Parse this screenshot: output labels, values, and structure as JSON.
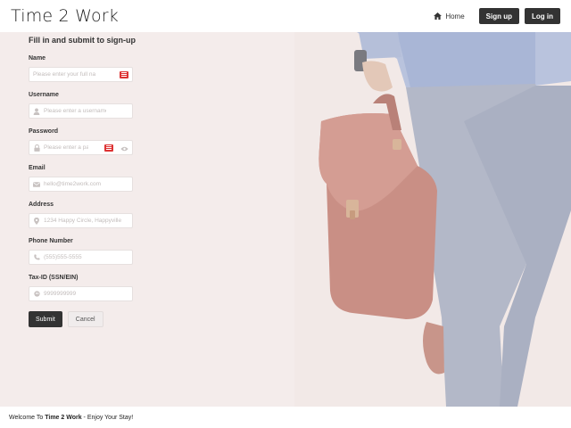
{
  "app": {
    "brand": "Time 2 Work"
  },
  "nav": {
    "home_label": "Home",
    "signup_label": "Sign up",
    "login_label": "Log in"
  },
  "form": {
    "title": "Fill in and submit to sign-up",
    "fields": {
      "name": {
        "label": "Name",
        "placeholder": "Please enter your full name"
      },
      "username": {
        "label": "Username",
        "placeholder": "Please enter a username"
      },
      "password": {
        "label": "Password",
        "placeholder": "Please enter a password"
      },
      "email": {
        "label": "Email",
        "placeholder": "hello@time2work.com"
      },
      "address": {
        "label": "Address",
        "placeholder": "1234 Happy Circle, Happyville"
      },
      "phone": {
        "label": "Phone Number",
        "placeholder": "(555)555-5555"
      },
      "taxid": {
        "label": "Tax-ID (SSN/EIN)",
        "placeholder": "9999999999"
      }
    },
    "submit_label": "Submit",
    "cancel_label": "Cancel"
  },
  "footer": {
    "prefix": "Welcome To ",
    "brand": "Time 2 Work",
    "suffix": " - Enjoy Your Stay!"
  },
  "icons": {
    "home": "home-icon",
    "user": "user-icon",
    "lock": "lock-icon",
    "email": "envelope-icon",
    "address": "map-marker-icon",
    "phone": "phone-icon",
    "taxid": "id-icon",
    "eye": "eye-icon",
    "password_manager": "password-manager-icon"
  },
  "colors": {
    "primary": "#333333",
    "autofill_badge": "#dd3333"
  }
}
